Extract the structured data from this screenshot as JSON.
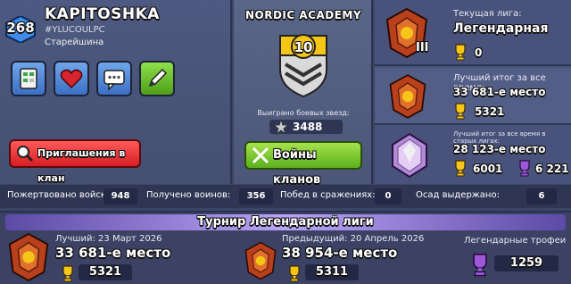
{
  "player": {
    "level": "268",
    "name": "KAPITOSHKA",
    "tag": "#YLUCOULPC",
    "role": "Старейшина"
  },
  "buttons": {
    "clan_invites": "Приглашения в клан",
    "clan_wars": "Войны кланов"
  },
  "clan": {
    "name": "NORDIC ACADEMY",
    "level": "10",
    "stars_label": "Выиграно боевых звезд:",
    "stars_value": "3488"
  },
  "league": {
    "current_label": "Текущая лига:",
    "current_name": "Легендарная",
    "current_trophies": "0",
    "best_label": "Лучший итог за все время:",
    "best_place": "33 681-е место",
    "best_trophies": "5321",
    "old_label": "Лучший итог за все время в старых лигах:",
    "old_place": "28 123-е место",
    "old_trophies": "6001",
    "old_builder_trophies": "6 221"
  },
  "stats": {
    "donated_label": "Пожертвовано войск:",
    "donated_value": "948",
    "received_label": "Получено воинов:",
    "received_value": "356",
    "attack_wins_label": "Побед в сражениях:",
    "attack_wins_value": "0",
    "defense_wins_label": "Осад выдержано:",
    "defense_wins_value": "6"
  },
  "tournament": {
    "title": "Турнир Легендарной лиги",
    "best_label": "Лучший: 23 Март 2026",
    "best_place": "33 681-е место",
    "best_trophies": "5321",
    "prev_label": "Предыдущий: 20 Апрель 2026",
    "prev_place": "38 954-е место",
    "prev_trophies": "5311",
    "legend_label": "Легендарные трофеи",
    "legend_value": "1259"
  },
  "colors": {
    "panel": "#4d5980",
    "red_button": "#d61e24",
    "green_button": "#5ab01c",
    "gold": "#f5c518",
    "banner": "#b9a4f5"
  },
  "icons": [
    "war-log-icon",
    "heart-icon",
    "chat-icon",
    "edit-icon",
    "trophy-icon",
    "builder-trophy-icon",
    "legend-trophy-icon",
    "star-icon",
    "legend-league-icon",
    "crystal-league-icon",
    "clan-badge-icon"
  ]
}
